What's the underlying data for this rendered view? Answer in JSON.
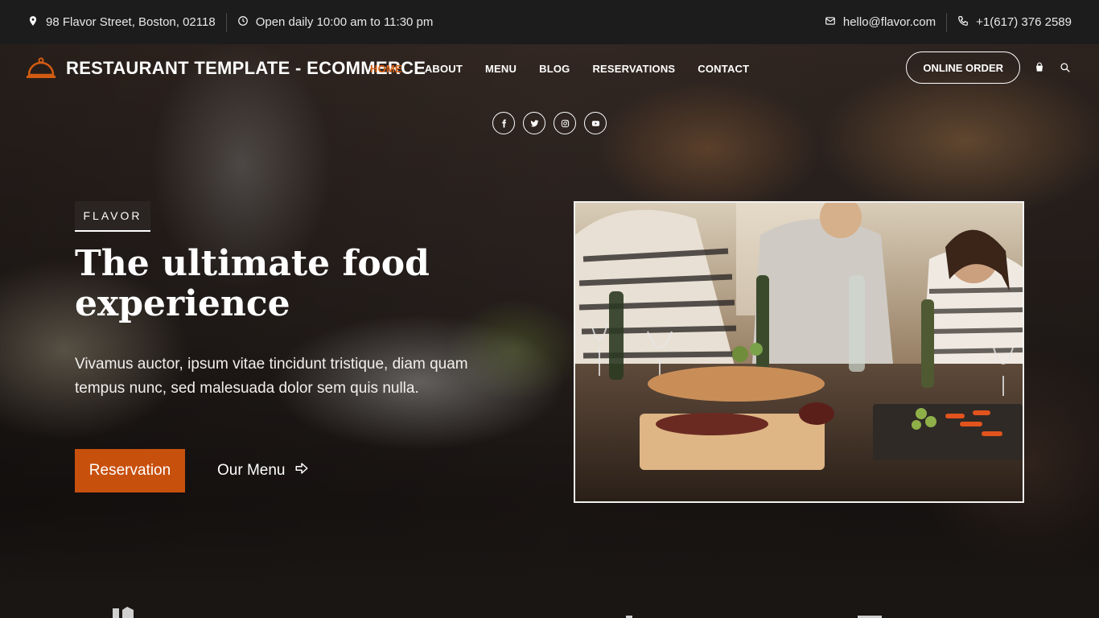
{
  "topbar": {
    "address": "98 Flavor Street, Boston, 02118",
    "hours": "Open daily 10:00 am to 11:30 pm",
    "email": "hello@flavor.com",
    "phone": "+1(617) 376 2589"
  },
  "header": {
    "logo_text": "RESTAURANT TEMPLATE - ECOMMERCE",
    "nav": [
      {
        "label": "HOME",
        "active": true
      },
      {
        "label": "ABOUT",
        "active": false
      },
      {
        "label": "MENU",
        "active": false
      },
      {
        "label": "BLOG",
        "active": false
      },
      {
        "label": "RESERVATIONS",
        "active": false
      },
      {
        "label": "CONTACT",
        "active": false
      }
    ],
    "order_label": "ONLINE ORDER",
    "icons": [
      "shopping-bag-icon",
      "search-icon"
    ]
  },
  "social": [
    "facebook-icon",
    "twitter-icon",
    "instagram-icon",
    "youtube-icon"
  ],
  "hero": {
    "tag": "FLAVOR",
    "headline": "The ultimate food experience",
    "lead": "Vivamus auctor, ipsum vitae tincidunt tristique, diam quam tempus nunc, sed malesuada dolor sem quis nulla.",
    "primary_button": "Reservation",
    "secondary_button": "Our Menu"
  },
  "colors": {
    "accent": "#c8500d",
    "topbar_bg": "#1c1c1c",
    "text": "#ffffff"
  }
}
